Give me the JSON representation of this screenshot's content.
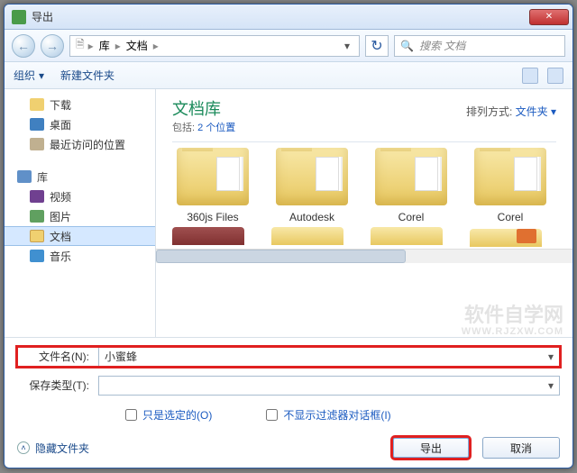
{
  "title": "导出",
  "breadcrumbs": {
    "root_icon": "▸",
    "items": [
      "库",
      "文档"
    ]
  },
  "search": {
    "placeholder": "搜索 文档"
  },
  "toolbar": {
    "organize": "组织",
    "new_folder": "新建文件夹"
  },
  "sidebar": {
    "quick": [
      {
        "label": "下载",
        "icon": "icon-dl"
      },
      {
        "label": "桌面",
        "icon": "icon-desk"
      },
      {
        "label": "最近访问的位置",
        "icon": "icon-recent"
      }
    ],
    "library_group": "库",
    "libraries": [
      {
        "label": "视频",
        "icon": "icon-vid"
      },
      {
        "label": "图片",
        "icon": "icon-pic"
      },
      {
        "label": "文档",
        "icon": "icon-doc",
        "selected": true
      },
      {
        "label": "音乐",
        "icon": "icon-mus"
      }
    ]
  },
  "content": {
    "title": "文档库",
    "subtitle_prefix": "包括: ",
    "subtitle_link": "2 个位置",
    "sort_label": "排列方式:",
    "sort_value": "文件夹",
    "folders": [
      "360js Files",
      "Autodesk",
      "Corel",
      "Corel"
    ]
  },
  "filename": {
    "label": "文件名(N):",
    "value": "小蜜蜂"
  },
  "filetype": {
    "label": "保存类型(T):",
    "value": ""
  },
  "checks": {
    "only_selected": "只是选定的(O)",
    "no_filter_dialog": "不显示过滤器对话框(I)"
  },
  "footer": {
    "hide_folders": "隐藏文件夹",
    "export": "导出",
    "cancel": "取消"
  },
  "watermark": {
    "line1": "软件自学网",
    "line2": "WWW.RJZXW.COM"
  }
}
